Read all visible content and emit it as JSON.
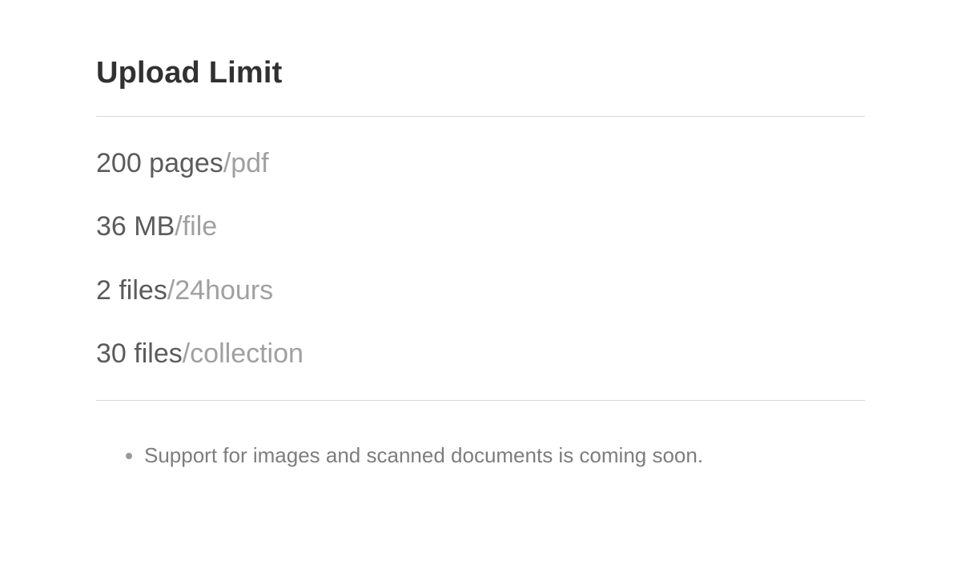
{
  "title": "Upload Limit",
  "limits": [
    {
      "value": "200 pages",
      "unit": "/pdf"
    },
    {
      "value": "36 MB",
      "unit": "/file"
    },
    {
      "value": "2 files",
      "unit": "/24hours"
    },
    {
      "value": "30 files",
      "unit": "/collection"
    }
  ],
  "notes": [
    "Support for images and scanned documents is coming soon."
  ]
}
